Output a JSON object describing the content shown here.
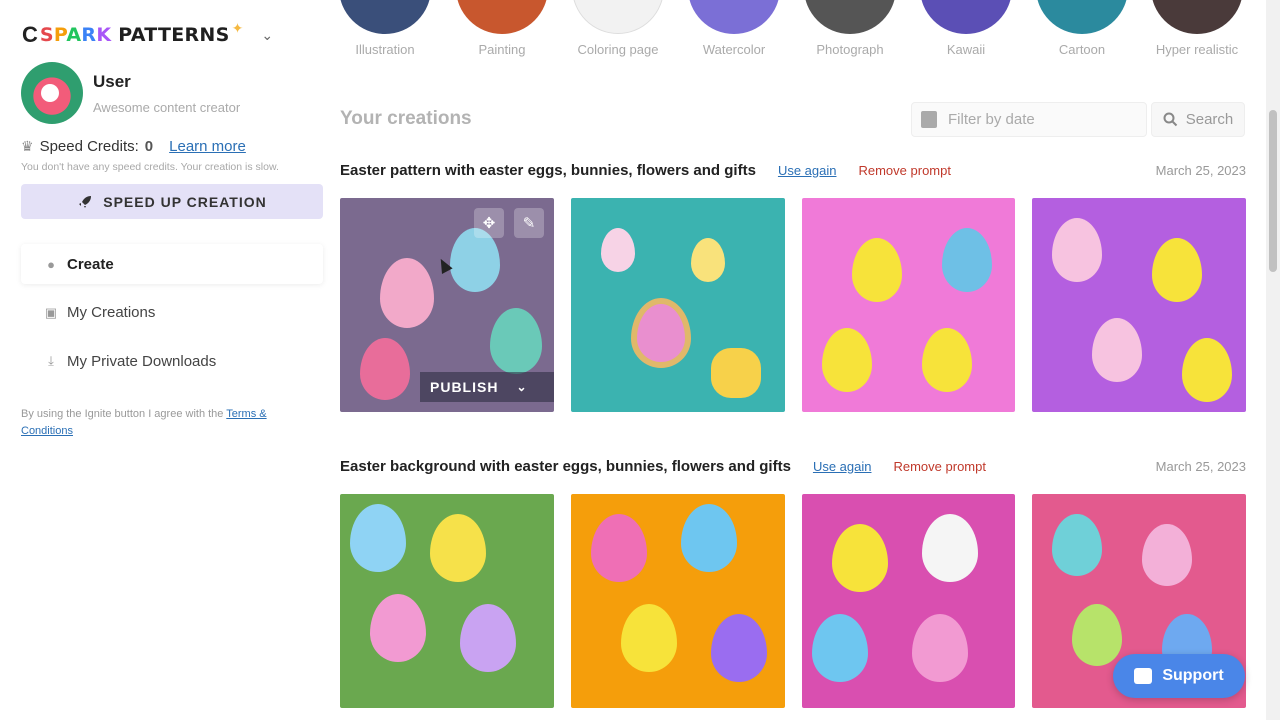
{
  "app": {
    "logo_c": "C",
    "logo_letters": [
      "S",
      "P",
      "A",
      "R",
      "K"
    ],
    "logo_rest": " PATTERNS"
  },
  "user": {
    "name": "User",
    "subtitle": "Awesome content creator"
  },
  "credits": {
    "label": "Speed Credits:",
    "value": "0",
    "learn_more": "Learn more",
    "note": "You don't have any speed credits. Your creation is slow."
  },
  "speed_button": {
    "label": "SPEED UP CREATION"
  },
  "nav": {
    "items": [
      {
        "label": "Create",
        "icon": "flame-icon"
      },
      {
        "label": "My Creations",
        "icon": "gallery-icon"
      },
      {
        "label": "My Private Downloads",
        "icon": "download-icon"
      }
    ]
  },
  "terms": {
    "prefix": "By using the Ignite button I agree with the ",
    "link": "Terms & Conditions"
  },
  "styles": [
    {
      "label": "Illustration",
      "color": "#3a4f7a"
    },
    {
      "label": "Painting",
      "color": "#c8572e"
    },
    {
      "label": "Coloring page",
      "color": "#f2f2f2"
    },
    {
      "label": "Watercolor",
      "color": "#7b6fd6"
    },
    {
      "label": "Photograph",
      "color": "#555555"
    },
    {
      "label": "Kawaii",
      "color": "#5b4fb5"
    },
    {
      "label": "Cartoon",
      "color": "#2b8a9e"
    },
    {
      "label": "Hyper realistic",
      "color": "#4a3a3a"
    }
  ],
  "creations": {
    "title": "Your creations",
    "filter_placeholder": "Filter by date",
    "search_label": "Search",
    "groups": [
      {
        "prompt": "Easter pattern with easter eggs, bunnies, flowers and gifts",
        "use_again": "Use again",
        "remove": "Remove prompt",
        "date": "March 25, 2023",
        "tiles": [
          "#7b6a8f",
          "#3bb3b0",
          "#f07ad8",
          "#b45fe0"
        ]
      },
      {
        "prompt": "Easter background with easter eggs, bunnies, flowers and gifts",
        "use_again": "Use again",
        "remove": "Remove prompt",
        "date": "March 25, 2023",
        "tiles": [
          "#6aa84f",
          "#f59e0b",
          "#d94fb0",
          "#e35a8e"
        ]
      }
    ]
  },
  "tile_actions": {
    "publish": "PUBLISH"
  },
  "support": {
    "label": "Support"
  }
}
